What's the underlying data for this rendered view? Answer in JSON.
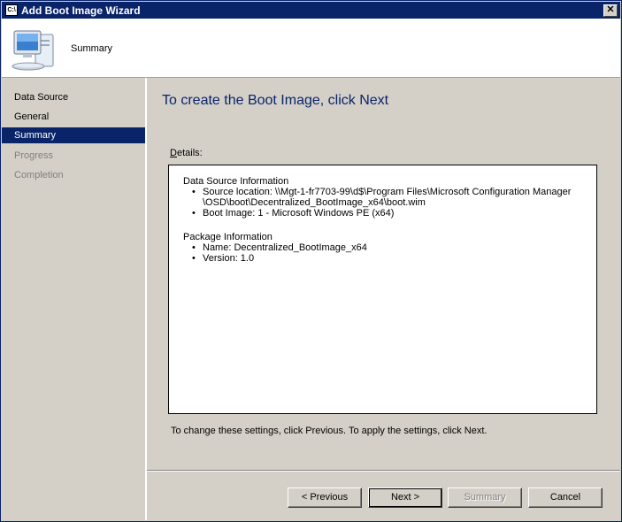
{
  "window": {
    "title": "Add Boot Image Wizard",
    "icon_text": "C:\\",
    "close_label": "✕"
  },
  "header": {
    "title": "Summary",
    "icon": "computer-icon"
  },
  "sidebar": {
    "items": [
      {
        "label": "Data Source",
        "state": "normal"
      },
      {
        "label": "General",
        "state": "normal"
      },
      {
        "label": "Summary",
        "state": "active"
      },
      {
        "label": "Progress",
        "state": "disabled"
      },
      {
        "label": "Completion",
        "state": "disabled"
      }
    ]
  },
  "main": {
    "heading": "To create the Boot Image, click Next",
    "details_label_first": "D",
    "details_label_rest": "etails:",
    "sections": [
      {
        "title": "Data Source Information",
        "bullets": [
          [
            "Source location: \\\\Mgt-1-fr7703-99\\d$\\Program Files\\Microsoft Configuration Manager",
            "\\OSD\\boot\\Decentralized_BootImage_x64\\boot.wim"
          ],
          [
            "Boot Image: 1 - Microsoft Windows PE (x64)"
          ]
        ]
      },
      {
        "title": "Package Information",
        "bullets": [
          [
            "Name: Decentralized_BootImage_x64"
          ],
          [
            "Version: 1.0"
          ]
        ]
      }
    ],
    "apply_text": "To change these settings, click Previous. To apply the settings, click Next."
  },
  "buttons": {
    "previous": "< Previous",
    "next": "Next >",
    "summary": "Summary",
    "cancel": "Cancel"
  },
  "colors": {
    "accent": "#0a246a",
    "face": "#d4d0c8",
    "heading": "#0a246a"
  }
}
